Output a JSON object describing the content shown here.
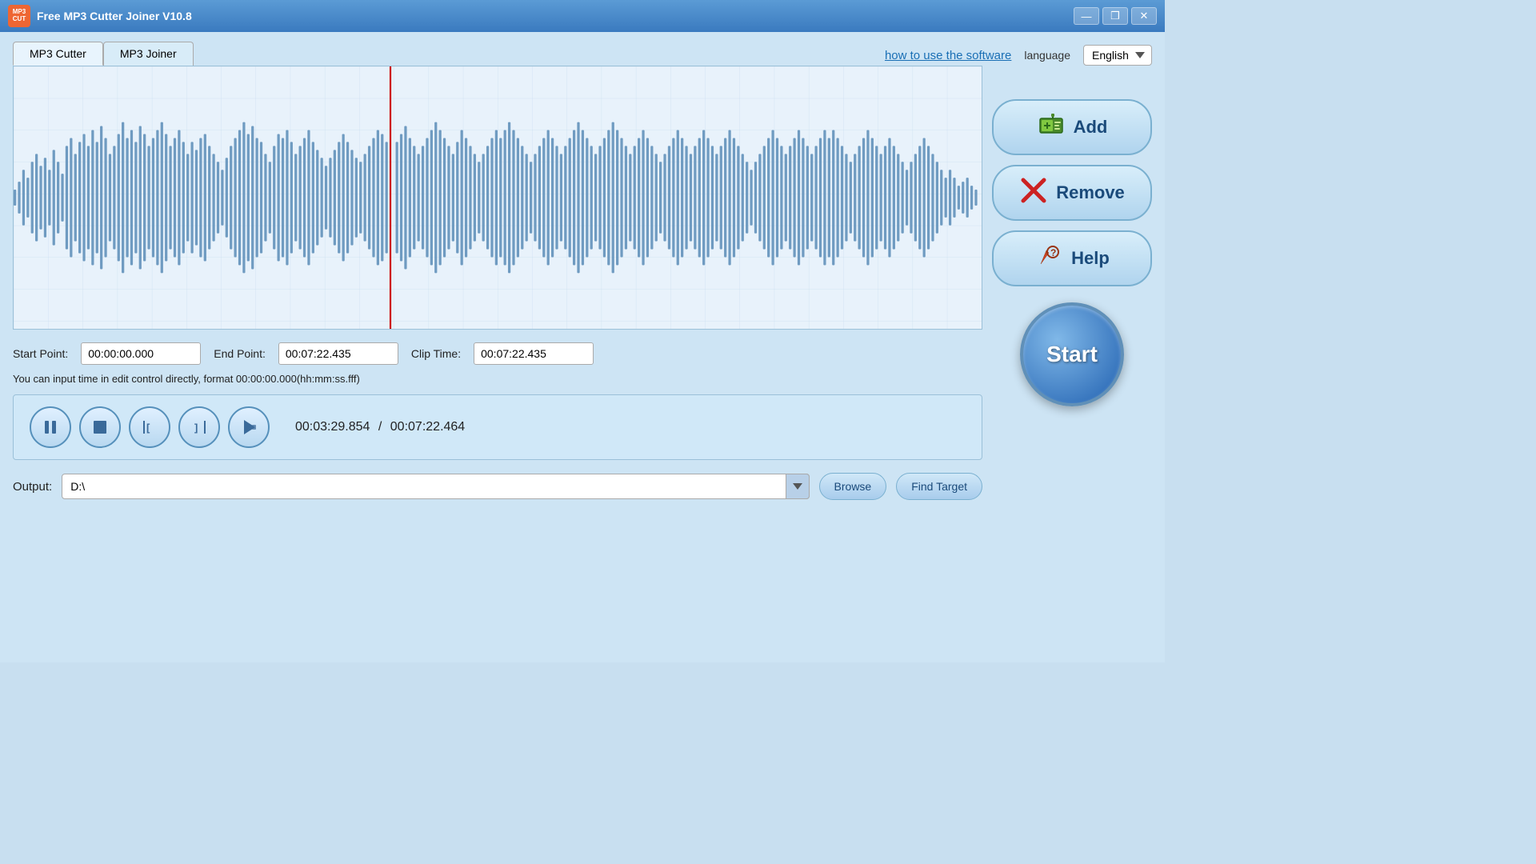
{
  "titleBar": {
    "appName": "Free MP3 Cutter Joiner V10.8",
    "iconText": "MP3\nCUT",
    "minimizeLabel": "—",
    "maximizeLabel": "❒",
    "closeLabel": "✕"
  },
  "tabs": {
    "tab1": "MP3 Cutter",
    "tab2": "MP3 Joiner",
    "howToLink": "how to use the software",
    "languageLabel": "language",
    "languageValue": "English"
  },
  "timeControls": {
    "startLabel": "Start Point:",
    "startValue": "00:00:00.000",
    "endLabel": "End Point:",
    "endValue": "00:07:22.435",
    "clipLabel": "Clip Time:",
    "clipValue": "00:07:22.435"
  },
  "hintText": "You can input time in edit control directly, format 00:00:00.000(hh:mm:ss.fff)",
  "player": {
    "currentTime": "00:03:29.854",
    "separator": "/",
    "totalTime": "00:07:22.464"
  },
  "output": {
    "label": "Output:",
    "value": "D:\\"
  },
  "buttons": {
    "addLabel": "Add",
    "removeLabel": "Remove",
    "helpLabel": "Help",
    "browseLabel": "Browse",
    "findTargetLabel": "Find Target",
    "startLabel": "Start"
  }
}
